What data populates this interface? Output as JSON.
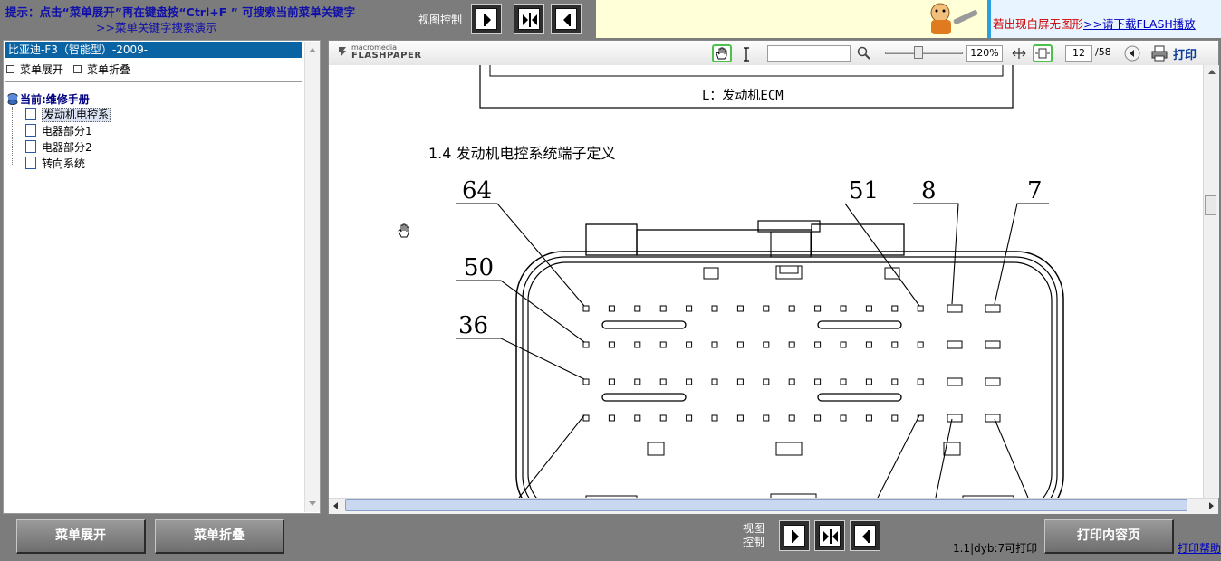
{
  "topbar": {
    "hint": "提示：点击“菜单展开”再在键盘按“Ctrl+F ” 可搜索当前菜单关键字",
    "hint_link": ">>菜单关键字搜索演示",
    "view_control_label": "视图控制",
    "banner_text": "若出现白屏无图形",
    "banner_link": ">>请下载FLASH播放"
  },
  "left_panel": {
    "book_title": "比亚迪-F3（智能型）-2009-",
    "expand_link": "菜单展开",
    "collapse_link": "菜单折叠",
    "tree_root": "当前:维修手册",
    "tree_items": [
      {
        "label": "发动机电控系",
        "selected": true
      },
      {
        "label": "电器部分1",
        "selected": false
      },
      {
        "label": "电器部分2",
        "selected": false
      },
      {
        "label": "转向系统",
        "selected": false
      }
    ]
  },
  "viewer": {
    "logo_small": "macromedia",
    "logo_big": "FLASHPAPER",
    "zoom": "120%",
    "page_current": "12",
    "page_total": "/58",
    "print_label": "打印",
    "icons": [
      "hand-tool-icon",
      "text-select-icon",
      "search-icon",
      "fit-width-icon",
      "fit-page-icon",
      "prev-page-icon",
      "printer-icon"
    ]
  },
  "document": {
    "ecm_label": "L：发动机ECM",
    "section_heading": "1.4  发动机电控系统端子定义",
    "pin_labels": [
      "64",
      "51",
      "8",
      "7",
      "50",
      "36"
    ]
  },
  "bottombar": {
    "expand_button": "菜单展开",
    "collapse_button": "菜单折叠",
    "view_control_label": "视图控制",
    "print_status": "1.1|dyb:7可打印",
    "print_button": "打印内容页",
    "print_help": "打印帮助"
  }
}
